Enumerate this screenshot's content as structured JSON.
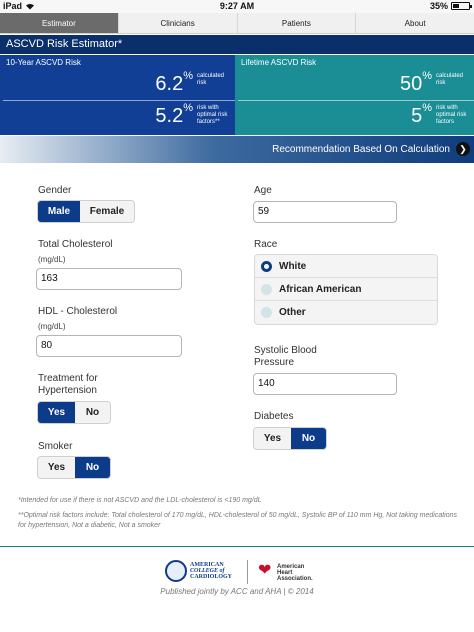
{
  "status_bar": {
    "device": "iPad",
    "time": "9:27 AM",
    "battery": "35%"
  },
  "tabs": [
    {
      "label": "Estimator"
    },
    {
      "label": "Clinicians"
    },
    {
      "label": "Patients"
    },
    {
      "label": "About"
    }
  ],
  "title": "ASCVD Risk Estimator*",
  "ten_year": {
    "heading": "10-Year ASCVD Risk",
    "calculated_value": "6.2",
    "calculated_unit": "%",
    "calculated_label": "calculated risk",
    "optimal_value": "5.2",
    "optimal_unit": "%",
    "optimal_label": "risk with optimal risk factors**"
  },
  "lifetime": {
    "heading": "Lifetime ASCVD Risk",
    "calculated_value": "50",
    "calculated_unit": "%",
    "calculated_label": "calculated risk",
    "optimal_value": "5",
    "optimal_unit": "%",
    "optimal_label": "risk with optimal risk factors"
  },
  "recommendation": {
    "label": "Recommendation Based On Calculation",
    "icon": "chevron-right-icon"
  },
  "form": {
    "gender": {
      "label": "Gender",
      "options": [
        "Male",
        "Female"
      ],
      "selected": "Male"
    },
    "age": {
      "label": "Age",
      "value": "59"
    },
    "total_cholesterol": {
      "label": "Total Cholesterol",
      "unit": "(mg/dL)",
      "value": "163"
    },
    "race": {
      "label": "Race",
      "options": [
        "White",
        "African American",
        "Other"
      ],
      "selected": "White"
    },
    "hdl": {
      "label": "HDL - Cholesterol",
      "unit": "(mg/dL)",
      "value": "80"
    },
    "systolic": {
      "label": "Systolic Blood Pressure",
      "value": "140"
    },
    "hypertension": {
      "label": "Treatment for Hypertension",
      "options": [
        "Yes",
        "No"
      ],
      "selected": "Yes"
    },
    "diabetes": {
      "label": "Diabetes",
      "options": [
        "Yes",
        "No"
      ],
      "selected": "No"
    },
    "smoker": {
      "label": "Smoker",
      "options": [
        "Yes",
        "No"
      ],
      "selected": "No"
    }
  },
  "notes": {
    "note1": "*Intended for use if there is not ASCVD and the LDL-cholesterol is <190 mg/dL",
    "note2": "**Optimal risk factors include: Total cholesterol of 170 mg/dL, HDL-cholesterol of 50 mg/dL, Systolic BP of 110 mm Hg, Not taking medications for hypertension, Not a diabetic, Not a smoker"
  },
  "footer": {
    "acc_line1": "AMERICAN",
    "acc_line2": "COLLEGE of",
    "acc_line3": "CARDIOLOGY",
    "aha_line1": "American",
    "aha_line2": "Heart",
    "aha_line3": "Association.",
    "published": "Published jointly by ACC and AHA | © 2014"
  },
  "colors": {
    "navy": "#0b2f6b",
    "ten_year_panel": "#103f95",
    "lifetime_panel": "#1a8d95",
    "selected_button": "#0c3b8a",
    "aha_red": "#c8102e"
  }
}
